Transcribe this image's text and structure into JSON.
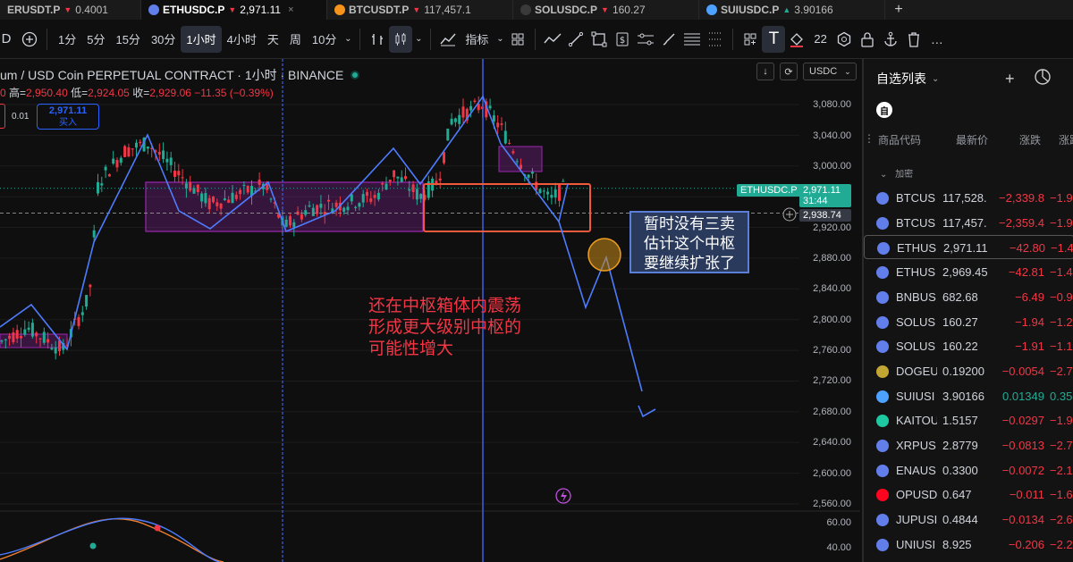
{
  "tabs": [
    {
      "symbol": "ERUSDT.P",
      "dir": "down",
      "price": "0.4001",
      "coin_color": "#f0b90b"
    },
    {
      "symbol": "ETHUSDC.P",
      "dir": "down",
      "price": "2,971.11",
      "coin_color": "#627eea"
    },
    {
      "symbol": "BTCUSDT.P",
      "dir": "down",
      "price": "117,457.1",
      "coin_color": "#f7931a"
    },
    {
      "symbol": "SOLUSDC.P",
      "dir": "down",
      "price": "160.27",
      "coin_color": "#2f2f2f"
    },
    {
      "symbol": "SUIUSDC.P",
      "dir": "up",
      "price": "3.90166",
      "coin_color": "#4da2ff"
    }
  ],
  "toolbar": {
    "intervals": [
      "1分",
      "5分",
      "15分",
      "30分",
      "1小时",
      "4小时",
      "天",
      "周",
      "10分"
    ],
    "active_interval": "1小时",
    "indicators_label": "指标",
    "font_size": "22"
  },
  "chart": {
    "title": "um / USD Coin PERPETUAL CONTRACT · 1小时 · BINANCE",
    "ohlc": {
      "open_value": "0",
      "high_label": "高=",
      "high": "2,950.40",
      "low_label": "低=",
      "low": "2,924.05",
      "close_label": "收=",
      "close": "2,929.06",
      "change": "−11.35 (−0.39%)"
    },
    "order_qty": "0.01",
    "buy_price": "2,971.11",
    "buy_label": "买入",
    "currency": "USDC",
    "price_axis": [
      "3,080.00",
      "3,040.00",
      "3,000.00",
      "2,960.00",
      "2,920.00",
      "2,880.00",
      "2,840.00",
      "2,800.00",
      "2,760.00",
      "2,720.00",
      "2,680.00",
      "2,640.00",
      "2,600.00",
      "2,560.00"
    ],
    "osc_axis": [
      "60.00",
      "40.00"
    ],
    "current_symbol_tag": "ETHUSDC.P",
    "current_price": "2,971.11",
    "countdown": "31:44",
    "crosshair_price": "2,938.74",
    "annotation_red": [
      "还在中枢箱体内震荡",
      "形成更大级别中枢的",
      "可能性增大"
    ],
    "annotation_box": [
      "暂时没有三卖",
      "估计这个中枢",
      "要继续扩张了"
    ],
    "colors": {
      "up": "#22ab94",
      "down": "#f23645",
      "box": "#9c27b0",
      "trend": "#4d7cfe"
    }
  },
  "watchlist": {
    "title": "自选列表",
    "avatar": "自",
    "columns": [
      "商品代码",
      "最新价",
      "涨跌",
      "涨跌"
    ],
    "group": "加密",
    "rows": [
      {
        "symbol": "BTCUS",
        "price": "117,528.",
        "change": "−2,339.8",
        "pct": "−1.9",
        "color": "#627eea",
        "sel": false
      },
      {
        "symbol": "BTCUS",
        "price": "117,457.",
        "change": "−2,359.4",
        "pct": "−1.9",
        "color": "#627eea",
        "sel": false
      },
      {
        "symbol": "ETHUS",
        "price": "2,971.11",
        "change": "−42.80",
        "pct": "−1.4",
        "color": "#627eea",
        "sel": true
      },
      {
        "symbol": "ETHUS",
        "price": "2,969.45",
        "change": "−42.81",
        "pct": "−1.4",
        "color": "#627eea",
        "sel": false
      },
      {
        "symbol": "BNBUS",
        "price": "682.68",
        "change": "−6.49",
        "pct": "−0.9",
        "color": "#627eea",
        "sel": false
      },
      {
        "symbol": "SOLUS",
        "price": "160.27",
        "change": "−1.94",
        "pct": "−1.2",
        "color": "#627eea",
        "sel": false
      },
      {
        "symbol": "SOLUS",
        "price": "160.22",
        "change": "−1.91",
        "pct": "−1.1",
        "color": "#627eea",
        "sel": false
      },
      {
        "symbol": "DOGEU",
        "price": "0.19200",
        "change": "−0.0054",
        "pct": "−2.7",
        "color": "#c2a633",
        "sel": false
      },
      {
        "symbol": "SUIUSI",
        "price": "3.90166",
        "change": "0.01349",
        "pct": "0.35",
        "color": "#4da2ff",
        "sel": false,
        "up": true
      },
      {
        "symbol": "KAITOU",
        "price": "1.5157",
        "change": "−0.0297",
        "pct": "−1.9",
        "color": "#1ec8a0",
        "sel": false
      },
      {
        "symbol": "XRPUS",
        "price": "2.8779",
        "change": "−0.0813",
        "pct": "−2.7",
        "color": "#627eea",
        "sel": false
      },
      {
        "symbol": "ENAUS",
        "price": "0.3300",
        "change": "−0.0072",
        "pct": "−2.1",
        "color": "#627eea",
        "sel": false
      },
      {
        "symbol": "OPUSD",
        "price": "0.647",
        "change": "−0.011",
        "pct": "−1.6",
        "color": "#ff0420",
        "sel": false
      },
      {
        "symbol": "JUPUSI",
        "price": "0.4844",
        "change": "−0.0134",
        "pct": "−2.6",
        "color": "#627eea",
        "sel": false
      },
      {
        "symbol": "UNIUSI",
        "price": "8.925",
        "change": "−0.206",
        "pct": "−2.2",
        "color": "#627eea",
        "sel": false
      }
    ]
  }
}
